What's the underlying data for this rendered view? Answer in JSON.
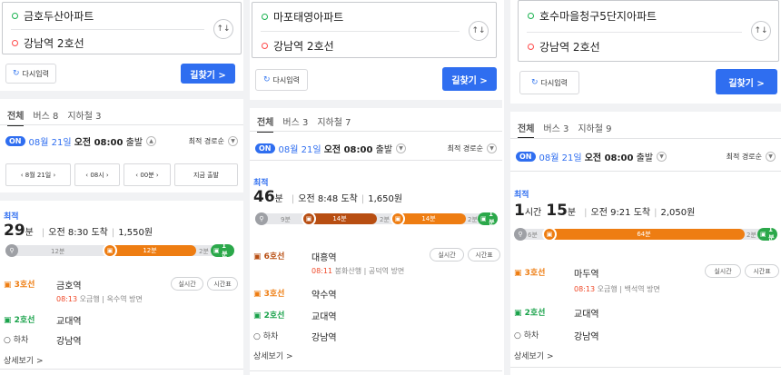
{
  "panels": [
    {
      "from": "금호두산아파트",
      "to": "강남역 2호선",
      "reset": "다시입력",
      "go": "길찾기 >",
      "tabs": [
        "전체",
        "버스 8",
        "지하철 3"
      ],
      "on": "ON",
      "date": "08월 21일",
      "time": "오전 08:00",
      "depart": "출발",
      "sort": "최적 경로순",
      "pickers": [
        "‹ 8월 21일 ›",
        "‹ 08시 ›",
        "‹ 00분 ›",
        "지금 출발"
      ],
      "best": "최적",
      "dur_num": "29",
      "dur_unit": "분",
      "arrive": "오전 8:30 도착",
      "fare": "1,550원",
      "bar": {
        "walk1": "12분",
        "ride": "12분",
        "walk2": "2분",
        "bus": "1분"
      },
      "steps": [
        {
          "line": "3호선",
          "station": "금호역",
          "time": "08:13",
          "detail": "오금행 | 옥수역 방면",
          "realtime": "실시간",
          "timetable": "시간표"
        },
        {
          "line": "2호선",
          "station": "교대역"
        },
        {
          "line": "하차",
          "station": "강남역"
        }
      ],
      "more": "상세보기 >"
    },
    {
      "from": "마포태영아파트",
      "to": "강남역 2호선",
      "reset": "다시입력",
      "go": "길찾기 >",
      "tabs": [
        "전체",
        "버스 3",
        "지하철 7"
      ],
      "on": "ON",
      "date": "08월 21일",
      "time": "오전 08:00",
      "depart": "출발",
      "sort": "최적 경로순",
      "best": "최적",
      "dur_num": "46",
      "dur_unit": "분",
      "arrive": "오전 8:48 도착",
      "fare": "1,650원",
      "bar": {
        "walk1": "9분",
        "ride1": "14분",
        "gap": "2분",
        "ride2": "14분",
        "walk2": "2분",
        "bus": "1분"
      },
      "steps": [
        {
          "line": "6호선",
          "station": "대흥역",
          "time": "08:11",
          "detail": "봉화산행 | 공덕역 방면",
          "realtime": "실시간",
          "timetable": "시간표"
        },
        {
          "line": "3호선",
          "station": "약수역"
        },
        {
          "line": "2호선",
          "station": "교대역"
        },
        {
          "line": "하차",
          "station": "강남역"
        }
      ],
      "more": "상세보기 >"
    },
    {
      "from": "호수마을청구5단지아파트",
      "to": "강남역 2호선",
      "reset": "다시입력",
      "go": "길찾기 >",
      "tabs": [
        "전체",
        "버스 3",
        "지하철 9"
      ],
      "on": "ON",
      "date": "08월 21일",
      "time": "오전 08:00",
      "depart": "출발",
      "sort": "최적 경로순",
      "best": "최적",
      "dur_num1": "1",
      "dur_unit1": "시간",
      "dur_num2": "15",
      "dur_unit2": "분",
      "arrive": "오전 9:21 도착",
      "fare": "2,050원",
      "bar": {
        "walk1": "6분",
        "ride": "64분",
        "walk2": "2분",
        "bus": "1분"
      },
      "steps": [
        {
          "line": "3호선",
          "station": "마두역",
          "time": "08:13",
          "detail": "오금행 | 백석역 방면",
          "realtime": "실시간",
          "timetable": "시간표"
        },
        {
          "line": "2호선",
          "station": "교대역"
        },
        {
          "line": "하차",
          "station": "강남역"
        }
      ],
      "more": "상세보기 >"
    }
  ],
  "colors": {
    "accent": "#2f6ef0",
    "line3": "#ee7d12",
    "line6": "#b84e12",
    "line2": "#2ba84a",
    "time": "#f04a2a"
  },
  "icons": {
    "swap": "swap-arrows-icon",
    "reset": "refresh-icon",
    "subway": "subway-icon",
    "walk": "walk-icon",
    "bus": "bus-icon"
  }
}
